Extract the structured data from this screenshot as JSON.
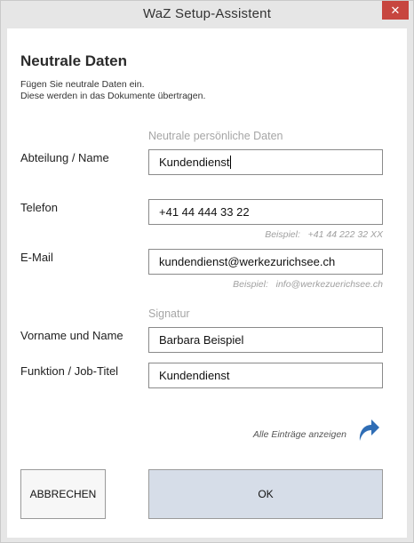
{
  "window": {
    "title": "WaZ Setup-Assistent",
    "close_symbol": "✕"
  },
  "header": {
    "heading": "Neutrale Daten",
    "intro_line1": "Fügen Sie neutrale Daten ein.",
    "intro_line2": "Diese werden in das Dokumente übertragen."
  },
  "sections": {
    "personal": "Neutrale persönliche Daten",
    "signature": "Signatur"
  },
  "fields": {
    "department": {
      "label": "Abteilung / Name",
      "value": "Kundendienst"
    },
    "phone": {
      "label": "Telefon",
      "value": "+41 44 444 33 22",
      "hint": "Beispiel:   +41 44 222 32 XX"
    },
    "email": {
      "label": "E-Mail",
      "value": "kundendienst@werkezurichsee.ch",
      "hint": "Beispiel:   info@werkezuerichsee.ch"
    },
    "fullname": {
      "label": "Vorname und Name",
      "value": "Barbara Beispiel"
    },
    "jobtitle": {
      "label": "Funktion / Job-Titel",
      "value": "Kundendienst"
    }
  },
  "actions": {
    "show_all": "Alle Einträge anzeigen",
    "cancel": "ABBRECHEN",
    "ok": "OK"
  },
  "colors": {
    "accent_arrow": "#2f6db5",
    "close_button": "#c7463f",
    "ok_button": "#d6dde8"
  },
  "icons": {
    "close": "close-icon",
    "show_all": "forward-arrow-icon"
  }
}
